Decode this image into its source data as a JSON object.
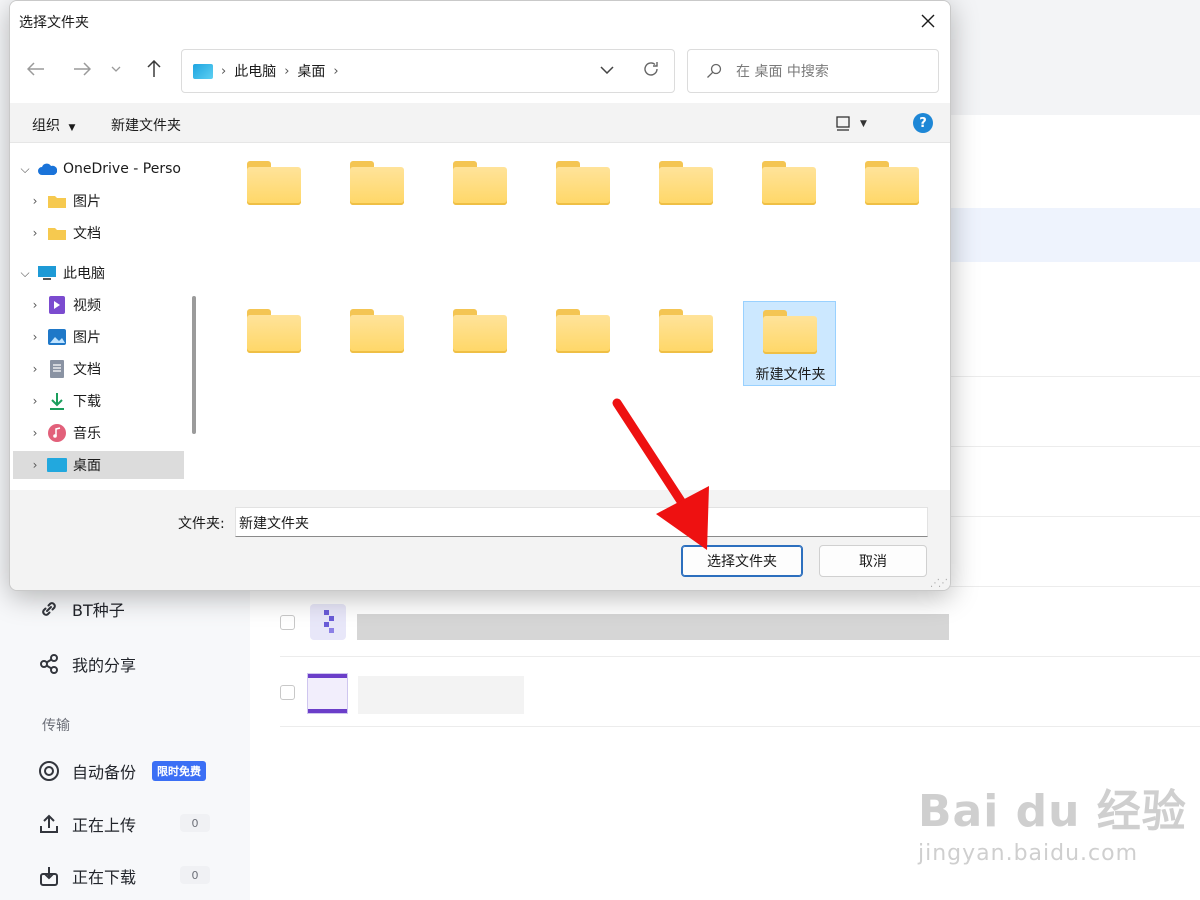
{
  "background_app": {
    "sidebar": {
      "items": [
        {
          "label": "BT种子",
          "icon": "link-icon"
        },
        {
          "label": "我的分享",
          "icon": "share-icon"
        }
      ],
      "section_transfer": "传输",
      "transfer_items": [
        {
          "label": "自动备份",
          "icon": "backup-icon",
          "badge": "限时免费"
        },
        {
          "label": "正在上传",
          "icon": "upload-icon",
          "count": "0"
        },
        {
          "label": "正在下载",
          "icon": "download-icon",
          "count": "0"
        }
      ]
    }
  },
  "dialog": {
    "title": "选择文件夹",
    "breadcrumb": [
      "此电脑",
      "桌面"
    ],
    "search_placeholder": "在 桌面 中搜索",
    "toolbar": {
      "organize": "组织",
      "new_folder": "新建文件夹"
    },
    "nav_tree": [
      {
        "label": "OneDrive - Perso",
        "icon": "onedrive-icon",
        "expanded": true,
        "level": 0
      },
      {
        "label": "图片",
        "icon": "folder-icon",
        "level": 1
      },
      {
        "label": "文档",
        "icon": "folder-icon",
        "level": 1
      },
      {
        "label": "此电脑",
        "icon": "computer-icon",
        "expanded": true,
        "level": 0
      },
      {
        "label": "视频",
        "icon": "video-icon",
        "level": 1
      },
      {
        "label": "图片",
        "icon": "pictures-icon",
        "level": 1
      },
      {
        "label": "文档",
        "icon": "document-icon",
        "level": 1
      },
      {
        "label": "下载",
        "icon": "download-icon",
        "level": 1
      },
      {
        "label": "音乐",
        "icon": "music-icon",
        "level": 1
      },
      {
        "label": "桌面",
        "icon": "desktop-icon",
        "level": 1,
        "selected": true
      }
    ],
    "selected_folder_label": "新建文件夹",
    "folder_field_label": "文件夹:",
    "folder_field_value": "新建文件夹",
    "select_button": "选择文件夹",
    "cancel_button": "取消"
  },
  "watermark": {
    "main": "Bai du 经验",
    "sub": "jingyan.baidu.com"
  },
  "colors": {
    "accent": "#1e87d6",
    "folder": "#ffd766",
    "selection": "#cce8ff",
    "arrow": "#ee1111"
  }
}
